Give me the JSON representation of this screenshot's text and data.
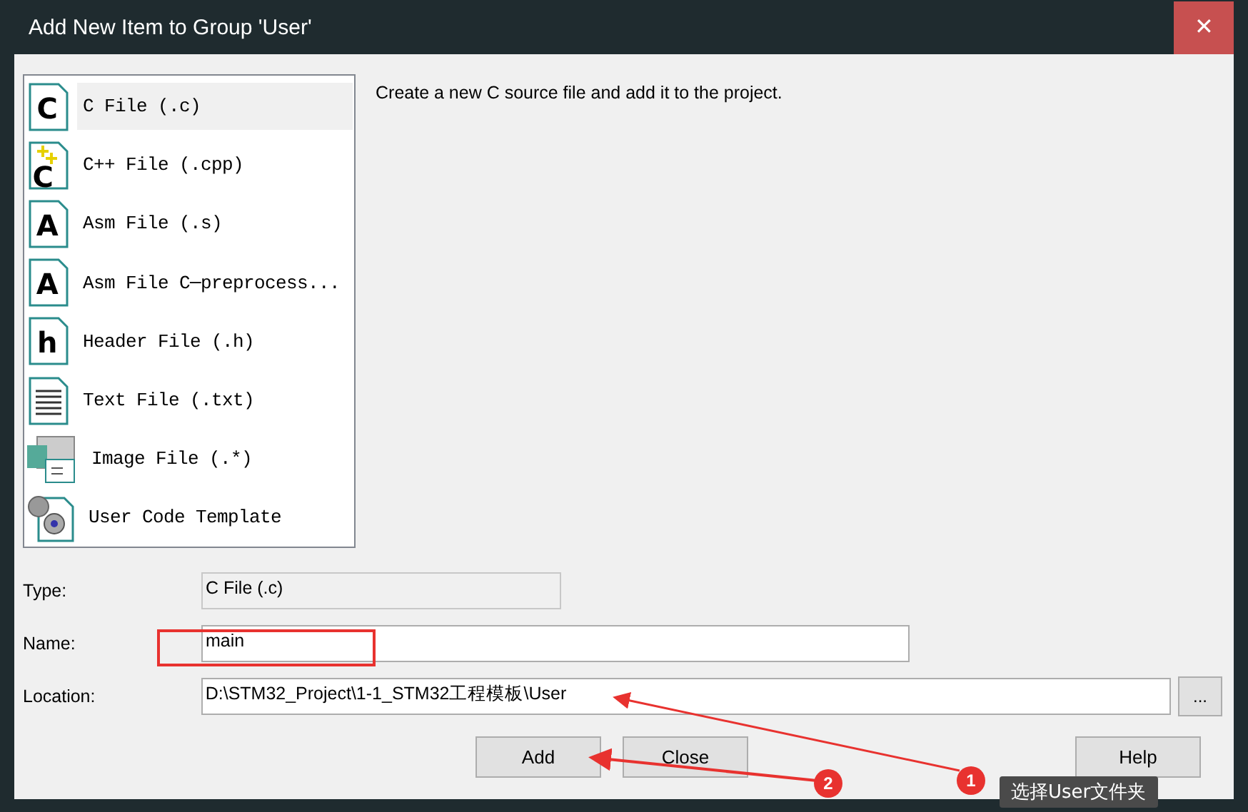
{
  "window": {
    "title": "Add New Item to Group 'User'",
    "close": "✕"
  },
  "items": [
    {
      "label": "C File (.c)",
      "kind": "letter",
      "glyph": "C",
      "selected": true
    },
    {
      "label": "C++ File (.cpp)",
      "kind": "cpp",
      "glyph": "C",
      "selected": false
    },
    {
      "label": "Asm File (.s)",
      "kind": "letter",
      "glyph": "A",
      "selected": false
    },
    {
      "label": "Asm File C─preprocess...",
      "kind": "letter",
      "glyph": "A",
      "selected": false
    },
    {
      "label": "Header File (.h)",
      "kind": "letter",
      "glyph": "h",
      "selected": false
    },
    {
      "label": "Text File (.txt)",
      "kind": "text",
      "selected": false
    },
    {
      "label": "Image File (.*)",
      "kind": "image",
      "selected": false
    },
    {
      "label": "User Code Template",
      "kind": "template",
      "selected": false
    }
  ],
  "description": "Create a new C source file and add it to the project.",
  "fields": [
    {
      "label": "Type:",
      "value": "C File (.c)",
      "kind": "readonly"
    },
    {
      "label": "Name:",
      "value": "main",
      "kind": "short"
    },
    {
      "label": "Location:",
      "value": "D:\\STM32_Project\\1-1_STM32工程模板\\User",
      "kind": "browse",
      "button": "..."
    }
  ],
  "buttons": [
    "Add",
    "Close",
    "Help"
  ],
  "annotations": {
    "badges": [
      "2",
      "1"
    ],
    "tooltip": "选择User文件夹"
  }
}
